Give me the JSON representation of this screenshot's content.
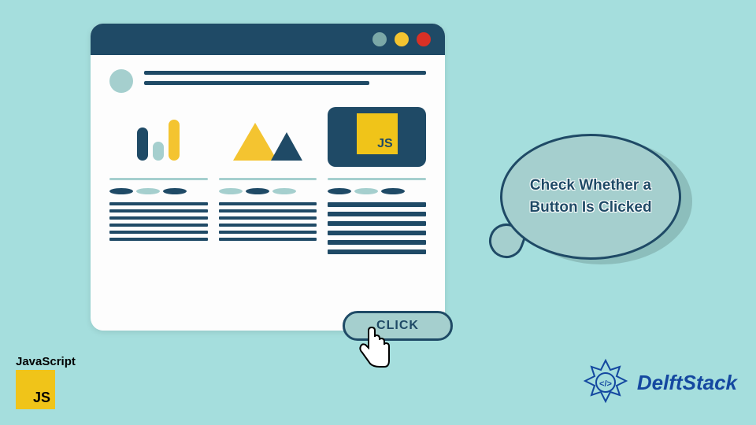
{
  "bubble": {
    "line1": "Check Whether a",
    "line2": "Button Is Clicked"
  },
  "button": {
    "label": "CLICK"
  },
  "jsCard": {
    "label": "JS"
  },
  "jsLogo": {
    "title": "JavaScript",
    "label": "JS"
  },
  "brand": {
    "name": "DelftStack"
  }
}
